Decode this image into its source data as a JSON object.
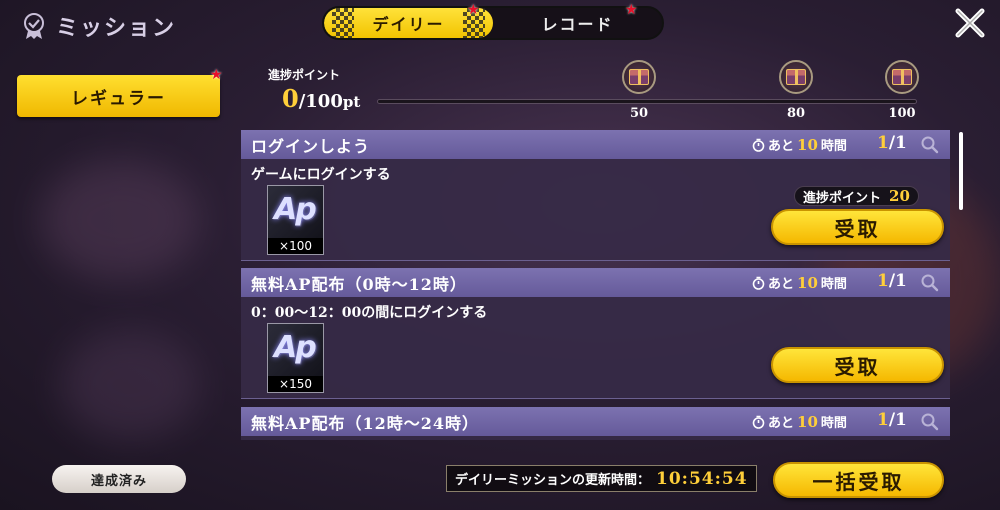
{
  "header": {
    "title": "ミッション",
    "tabs": [
      {
        "label": "デイリー",
        "active": true,
        "has_alert": true
      },
      {
        "label": "レコード",
        "active": false,
        "has_alert": true
      }
    ]
  },
  "sidebar": {
    "category_button": "レギュラー",
    "achieved_button": "達成済み"
  },
  "progress": {
    "label": "進捗ポイント",
    "current": "0",
    "max": "/100",
    "unit": "pt",
    "fill_fraction": 0,
    "milestones": [
      "50",
      "80",
      "100"
    ]
  },
  "missions": [
    {
      "title": "ログインしよう",
      "time_prefix": "あと",
      "time_value": "10",
      "time_unit": "時間",
      "count_done": "1",
      "count_total": "/1",
      "description": "ゲームにログインする",
      "reward_icon_text": "Ap",
      "reward_qty": "×100",
      "points_label": "進捗ポイント",
      "points_value": "20",
      "claim_label": "受取"
    },
    {
      "title": "無料AP配布（0時～12時）",
      "time_prefix": "あと",
      "time_value": "10",
      "time_unit": "時間",
      "count_done": "1",
      "count_total": "/1",
      "description": "0：00～12：00の間にログインする",
      "reward_icon_text": "Ap",
      "reward_qty": "×150",
      "claim_label": "受取"
    },
    {
      "title": "無料AP配布（12時～24時）",
      "time_prefix": "あと",
      "time_value": "10",
      "time_unit": "時間",
      "count_done": "1",
      "count_total": "/1"
    }
  ],
  "footer": {
    "refresh_label": "デイリーミッションの更新時間：",
    "refresh_time": "10:54:54",
    "bulk_claim_label": "一括受取"
  },
  "colors": {
    "accent_yellow": "#ffcf3a",
    "header_purple": "#7c72b0",
    "alert_red": "#e8102a"
  }
}
